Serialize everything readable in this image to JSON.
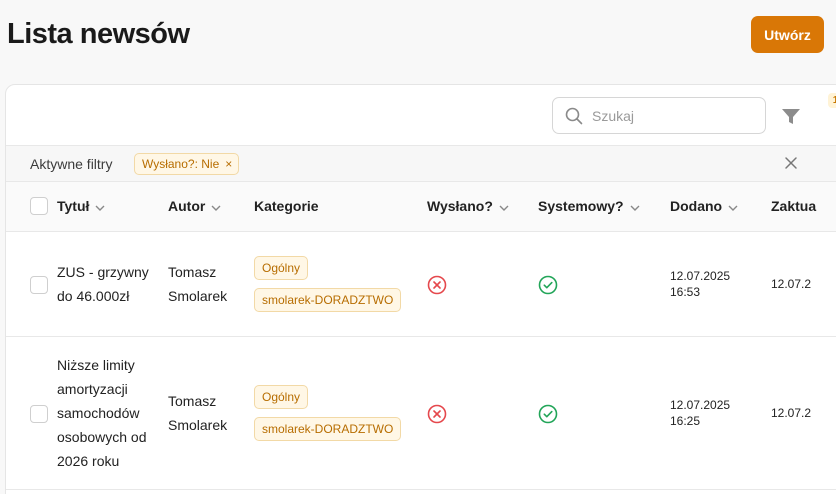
{
  "page": {
    "title": "Lista newsów",
    "create_label": "Utwórz"
  },
  "toolbar": {
    "search_placeholder": "Szukaj",
    "filter_count": "1"
  },
  "active_filters": {
    "label": "Aktywne filtry",
    "chip_label": "Wysłano?: Nie"
  },
  "columns": {
    "title": "Tytuł",
    "author": "Autor",
    "categories": "Kategorie",
    "sent": "Wysłano?",
    "system": "Systemowy?",
    "added": "Dodano",
    "updated": "Zaktua"
  },
  "rows": [
    {
      "title": "ZUS - grzywny do 46.000zł",
      "author": "Tomasz Smolarek",
      "tags": [
        "Ogólny",
        "smolarek-DORADZTWO"
      ],
      "sent": "no",
      "system": "yes",
      "added_date": "12.07.2025",
      "added_time": "16:53",
      "updated": "12.07.2"
    },
    {
      "title": "Niższe limity amortyzacji samochodów osobowych od 2026 roku",
      "author": "Tomasz Smolarek",
      "tags": [
        "Ogólny",
        "smolarek-DORADZTWO"
      ],
      "sent": "no",
      "system": "yes",
      "added_date": "12.07.2025",
      "added_time": "16:25",
      "updated": "12.07.2"
    }
  ],
  "colors": {
    "accent": "#d97706",
    "error": "#e5484d",
    "success": "#22a559"
  }
}
